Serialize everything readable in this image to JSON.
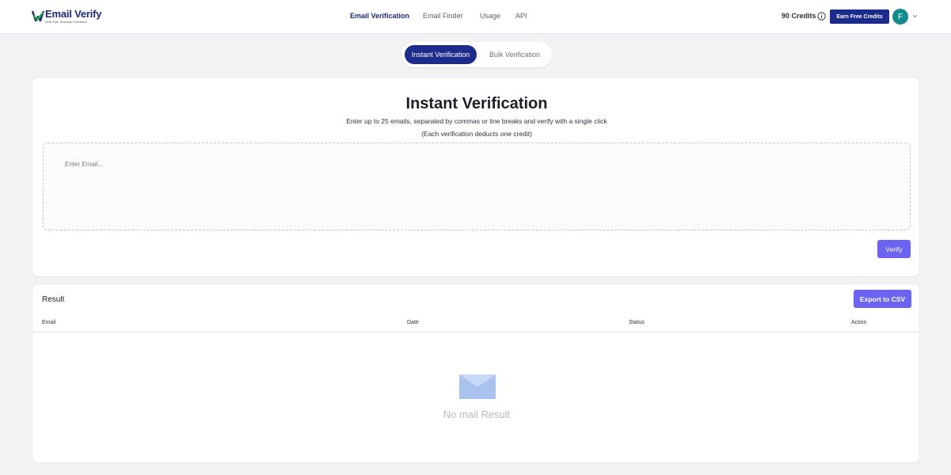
{
  "logo": {
    "title": "Email Verify",
    "tagline": "Verify Fast, Send with Confidence"
  },
  "nav": {
    "items": [
      {
        "label": "Email Verification",
        "active": true
      },
      {
        "label": "Email Finder",
        "active": false
      },
      {
        "label": "Usage",
        "active": false
      },
      {
        "label": "API",
        "active": false
      }
    ]
  },
  "header": {
    "credits": "90 Credits",
    "earn_label": "Earn Free Credits",
    "avatar_letter": "F"
  },
  "tabs": {
    "instant": "Instant Verification",
    "bulk": "Bulk Verification"
  },
  "instant": {
    "title": "Instant Verification",
    "subtitle1": "Enter up to 25 emails, separated by commas or line breaks and verify with a single click",
    "subtitle2": "(Each verification deducts one credit)",
    "email_placeholder": "Enter Email...",
    "email_value": "",
    "verify_label": "Verify"
  },
  "result": {
    "label": "Result",
    "export_label": "Export to CSV",
    "columns": [
      "Email",
      "Date",
      "Status",
      "Action"
    ],
    "empty_text": "No mail Result"
  },
  "colors": {
    "brand": "#1c2c8c",
    "button": "#6c63f0",
    "avatar": "#128b8c",
    "background": "#f1f2f4"
  },
  "icons": [
    "logo-check-icon",
    "info-icon",
    "chevron-down-icon",
    "envelope-icon"
  ]
}
